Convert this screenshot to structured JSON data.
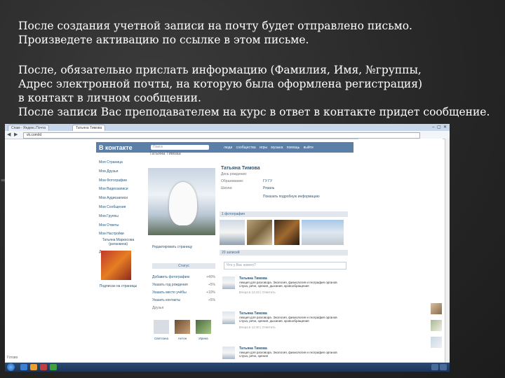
{
  "slide": {
    "paragraph1": [
      "После создания учетной записи на почту будет отправлено письмо.",
      "Произведете активацию по ссылке в этом письме."
    ],
    "paragraph2": [
      "После, обязательно прислать информацию (Фамилия, Имя, №группы,",
      "Адрес электронной почты, на которую была оформлена регистрация)",
      "в контакт в личном сообщении.",
      "После записи Вас преподавателем на курс в ответ в контакте придет сообщение."
    ],
    "brace": "{"
  },
  "browser": {
    "tab1": "Спам - Яндекс.Почта",
    "tab2": "Татьяна Тимова",
    "url": "vk.com/id",
    "status": "Готово"
  },
  "vk": {
    "logo": "В контакте",
    "search_placeholder": "Поиск",
    "nav": "люди сообщества игры музыка помощь выйти",
    "left_menu": [
      "Моя Страница",
      "Мои Друзья",
      "Мои Фотографии",
      "Мои Видеозаписи",
      "Мои Аудиозаписи",
      "Мои Сообщения",
      "Мои Группы",
      "Мои Ответы",
      "Мои Настройки",
      "",
      "Документы"
    ],
    "left_name": "Татьяна Маркосова (ратанкина)",
    "left_caption": "Подписан на страницы",
    "profile_header": "Татьяна Тимова",
    "info_name": "Татьяна Тимова",
    "info_rows": [
      {
        "label": "День рождения:",
        "value": ""
      },
      {
        "label": "Образование:",
        "value": "ГУ ГУ"
      },
      {
        "label": "Школа:",
        "value": "Рязань"
      }
    ],
    "info_more": "Показать подробную информацию",
    "photos_header": "1 фотография",
    "wall_header": "20 записей",
    "wall_placeholder": "Что у Вас нового?",
    "owl_caption": "Редактировать страницу",
    "btn_label": "Статус",
    "stats": [
      {
        "label": "Добавить фотографию",
        "value": "+40%"
      },
      {
        "label": "Указать год рождения",
        "value": "+5%"
      },
      {
        "label": "Указать место учёбы",
        "value": "+10%"
      },
      {
        "label": "Указать контакты",
        "value": "+5%"
      }
    ],
    "friends_header": "Друзья",
    "friends": [
      "Светлана",
      "Антон",
      "Ирина"
    ],
    "posts": [
      {
        "name": "Татьяна Тимова",
        "text": "лекция для разговора. Экология, физиология и география органов слуха, речи, зрения, дыхания, кровообращения",
        "meta": "Вчера в 12:43 | Ответить"
      },
      {
        "name": "Татьяна Тимова",
        "text": "лекция для разговора. Экология, физиология и география органов слуха, речи, зрения, дыхания, кровообращения",
        "meta": "Вчера в 12:40 | Ответить"
      },
      {
        "name": "Татьяна Тимова",
        "text": "лекция для разговора. Экология, физиология и география органов слуха, речи, зрения",
        "meta": "Вчера в 12:38 | Ответить"
      }
    ]
  }
}
